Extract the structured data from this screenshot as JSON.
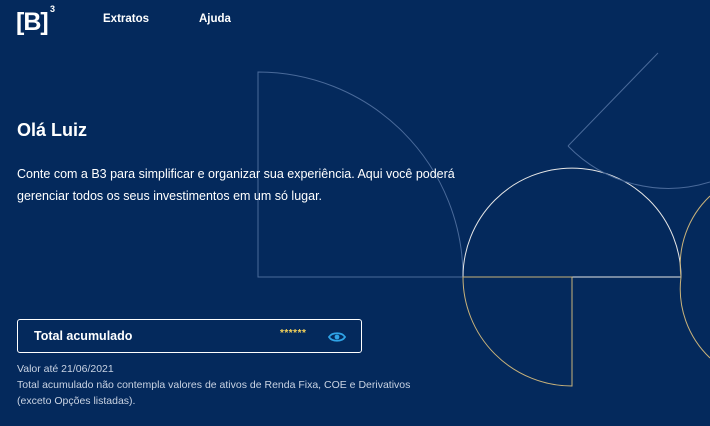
{
  "header": {
    "logo_text": "[B]",
    "logo_sup": "3",
    "nav": [
      {
        "label": "Extratos"
      },
      {
        "label": "Ajuda"
      }
    ]
  },
  "main": {
    "greeting": "Olá Luiz",
    "intro": "Conte com a B3 para simplificar e organizar sua experiência. Aqui você poderá gerenciar todos os seus investimentos em um só lugar.",
    "total": {
      "label": "Total acumulado",
      "value": "******",
      "icon": "eye-icon"
    },
    "notes": {
      "date_line": "Valor até 21/06/2021",
      "disclaimer": "Total acumulado não contempla valores de ativos de Renda Fixa, COE e Derivativos (exceto Opções listadas)."
    }
  },
  "colors": {
    "background": "#04295c",
    "masked_value": "#f5d35b",
    "eye_icon": "#2fa3e6"
  }
}
